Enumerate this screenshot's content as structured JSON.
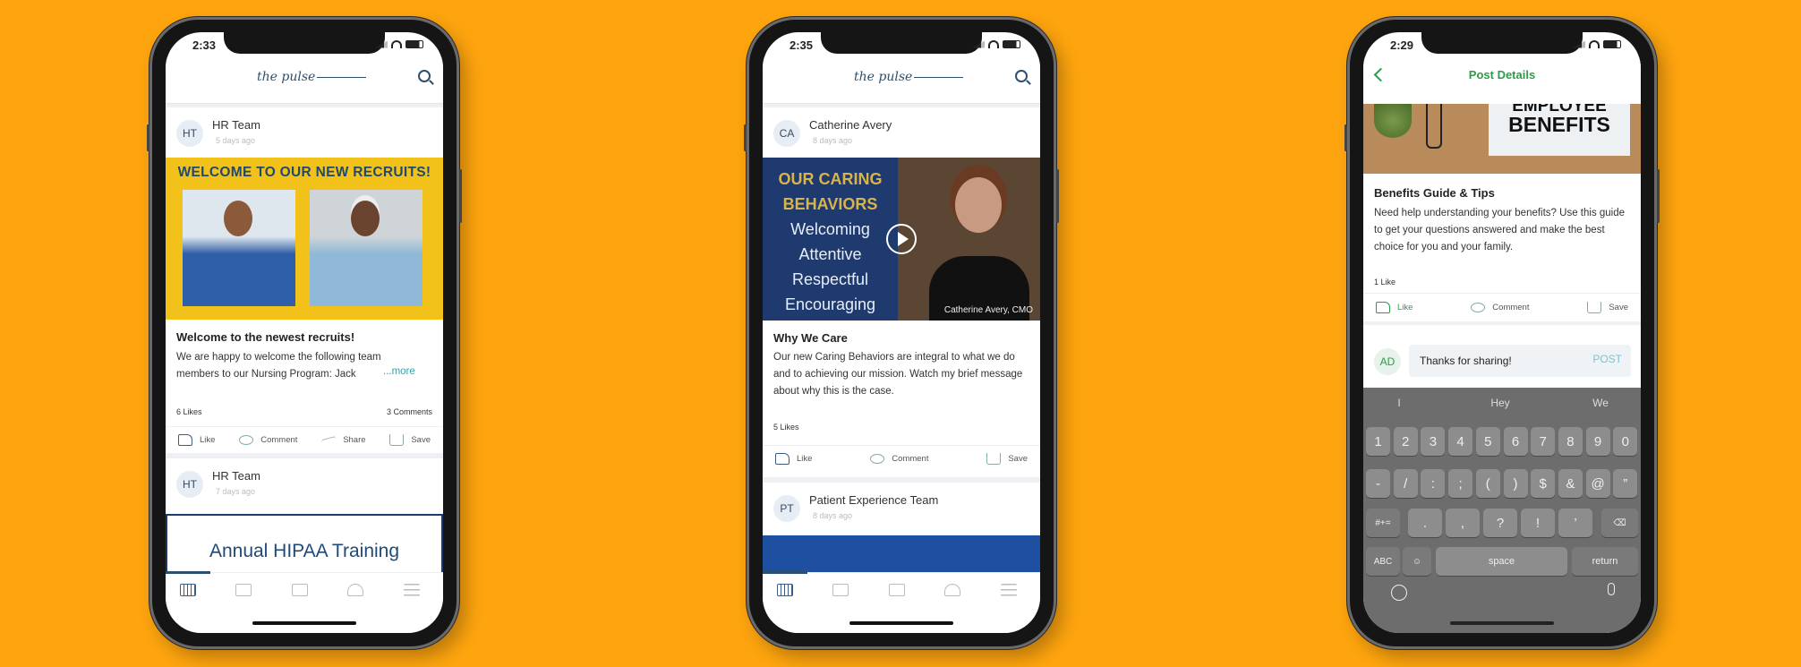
{
  "colors": {
    "background": "#FDA40E",
    "brand": "#2d4f6b",
    "green": "#2e9a4a",
    "more_link": "#3aa0a8",
    "keyboard": "#6d6d6d"
  },
  "logo_text": "the pulse",
  "phones": [
    {
      "status_time": "2:33",
      "posts": [
        {
          "initials": "HT",
          "author": "HR Team",
          "ago": "5 days ago",
          "banner": "WELCOME TO OUR NEW RECRUITS!",
          "title": "Welcome to the newest recruits!",
          "body": "We are happy to welcome the following team members to our Nursing Program: Jack",
          "more": "...more",
          "likes": "6 Likes",
          "comments": "3 Comments",
          "actions": [
            "Like",
            "Comment",
            "Share",
            "Save"
          ]
        },
        {
          "initials": "HT",
          "author": "HR Team",
          "ago": "7 days ago",
          "image_title": "Annual HIPAA Training"
        }
      ]
    },
    {
      "status_time": "2:35",
      "posts": [
        {
          "initials": "CA",
          "author": "Catherine Avery",
          "ago": "8 days ago",
          "video_lines": [
            "OUR CARING",
            "BEHAVIORS",
            "Welcoming",
            "Attentive",
            "Respectful",
            "Encouraging"
          ],
          "video_caption": "Catherine Avery, CMO",
          "title": "Why We Care",
          "body": "Our new Caring Behaviors are integral to what we do and to achieving our mission. Watch my brief message about why this is the case.",
          "likes": "5 Likes",
          "actions": [
            "Like",
            "Comment",
            "Save"
          ]
        },
        {
          "initials": "PT",
          "author": "Patient Experience Team",
          "ago": "8 days ago"
        }
      ]
    },
    {
      "status_time": "2:29",
      "header_title": "Post Details",
      "post": {
        "image_text": [
          "EMPLOYEE",
          "BENEFITS"
        ],
        "title": "Benefits Guide & Tips",
        "body": "Need help understanding your benefits? Use this guide to get your questions answered and make the best choice for you and your family.",
        "likes": "1 Like",
        "actions": [
          "Like",
          "Comment",
          "Save"
        ]
      },
      "comment": {
        "initials": "AD",
        "value": "Thanks for sharing!",
        "post_label": "POST"
      },
      "keyboard": {
        "suggestions": [
          "I",
          "Hey",
          "We"
        ],
        "row1": [
          "1",
          "2",
          "3",
          "4",
          "5",
          "6",
          "7",
          "8",
          "9",
          "0"
        ],
        "row2": [
          "-",
          "/",
          ":",
          ";",
          "(",
          ")",
          "$",
          "&",
          "@",
          "”"
        ],
        "row3": [
          "#+=",
          ".",
          ",",
          "?",
          "!",
          "’",
          "⌫"
        ],
        "row4": [
          "ABC",
          "☺",
          "space",
          "return"
        ]
      }
    }
  ]
}
